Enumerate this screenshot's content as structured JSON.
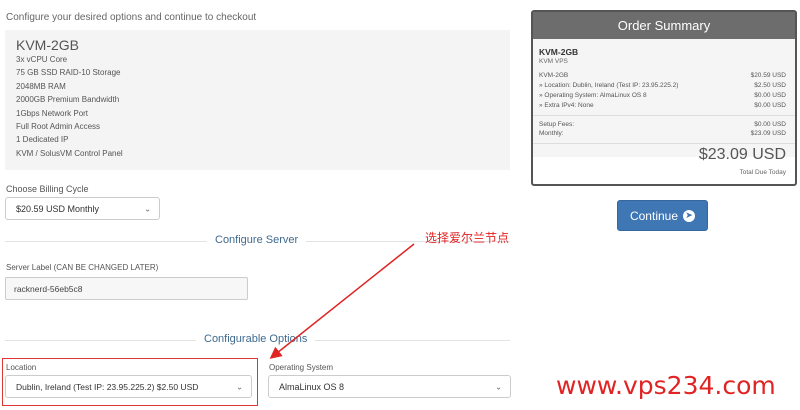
{
  "intro": "Configure your desired options and continue to checkout",
  "product": {
    "name": "KVM-2GB",
    "features": [
      "3x vCPU Core",
      "75 GB SSD RAID-10 Storage",
      "2048MB RAM",
      "2000GB Premium Bandwidth",
      "1Gbps Network Port",
      "Full Root Admin Access",
      "1 Dedicated IP",
      "KVM / SolusVM Control Panel"
    ]
  },
  "billing": {
    "label": "Choose Billing Cycle",
    "selected": "$20.59 USD Monthly"
  },
  "configure_server": {
    "heading": "Configure Server",
    "server_label": "Server Label (CAN BE CHANGED LATER)",
    "server_value": "racknerd-56eb5c8"
  },
  "configurable_options": {
    "heading": "Configurable Options",
    "location_label": "Location",
    "location_value": "Dublin, Ireland (Test IP: 23.95.225.2) $2.50 USD",
    "os_label": "Operating System",
    "os_value": "AlmaLinux OS 8"
  },
  "order_summary": {
    "title": "Order Summary",
    "product": "KVM-2GB",
    "group": "KVM VPS",
    "lines": [
      {
        "label": "KVM-2GB",
        "price": "$20.59 USD"
      },
      {
        "label": "» Location: Dublin, Ireland (Test IP: 23.95.225.2)",
        "price": "$2.50 USD"
      },
      {
        "label": "» Operating System: AlmaLinux OS 8",
        "price": "$0.00 USD"
      },
      {
        "label": "» Extra IPv4: None",
        "price": "$0.00 USD"
      }
    ],
    "setup_label": "Setup Fees:",
    "setup_value": "$0.00 USD",
    "monthly_label": "Monthly:",
    "monthly_value": "$23.09 USD",
    "total": "$23.09 USD",
    "total_label": "Total Due Today"
  },
  "continue_label": "Continue",
  "annotation": "选择爱尔兰节点",
  "watermark": "www.vps234.com",
  "colors": {
    "accent": "#3f76b4",
    "heading": "#3f6a8f",
    "annotation": "#e02424"
  }
}
